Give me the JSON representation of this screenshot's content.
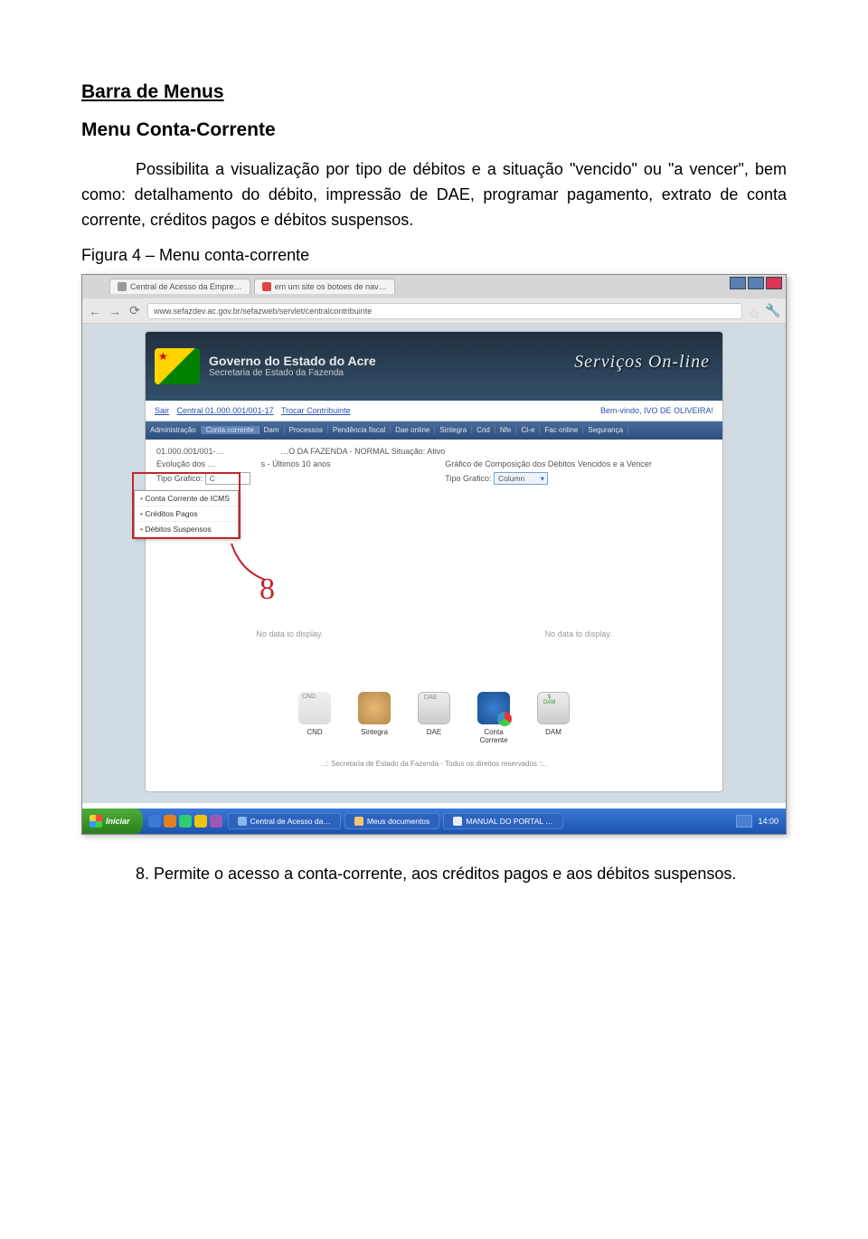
{
  "doc": {
    "title": "Barra de Menus",
    "subtitle": "Menu Conta-Corrente",
    "paragraph1": "Possibilita a visualização por tipo de débitos e a situação \"vencido\" ou \"a vencer\",  bem como: detalhamento do débito, impressão de DAE,  programar pagamento,  extrato de conta corrente, créditos pagos e débitos suspensos.",
    "figure_caption": "Figura 4 – Menu conta-corrente",
    "callout_number": "8",
    "paragraph2": "8. Permite o acesso a conta-corrente, aos créditos pagos e aos débitos suspensos."
  },
  "browser": {
    "tab1": "Central de Acesso da Empre…",
    "tab2": "em um site os botoes de nav…",
    "url": "www.sefazdev.ac.gov.br/sefazweb/servlet/centralcontribuinte"
  },
  "portal": {
    "banner_line1": "Governo do Estado do Acre",
    "banner_line2": "Secretaria de Estado da Fazenda",
    "banner_right": "Serviços On-line",
    "link_sair": "Sair",
    "link_central": "Central 01.000.001/001-17",
    "link_trocar": "Trocar Contribuinte",
    "welcome": "Bem-vindo, IVO DE OLIVEIRA!",
    "menu": {
      "administracao": "Administração",
      "conta_corrente": "Conta corrente",
      "dam": "Dam",
      "processos": "Processos",
      "pendencia": "Pendência fiscal",
      "dae_online": "Dae online",
      "sintegra": "Sintegra",
      "cnd": "Cnd",
      "nfe": "Nfe",
      "cte": "Ct-e",
      "fac": "Fac online",
      "seguranca": "Segurança"
    },
    "dropdown": {
      "icms": "Conta Corrente de ICMS",
      "creditos": "Créditos Pagos",
      "debitos": "Débitos Suspensos"
    },
    "body": {
      "line1_left": "01.000.001/001-…",
      "line1_right": "…O DA FAZENDA - NORMAL Situação: Ativo",
      "line2_left": "Evolução dos …",
      "line2_right": "s - Últimos 10 anos",
      "line2_right_col": "Gráfico de Composição dos Débitos Vencidos e a Vencer",
      "tipo_grafico_label": "Tipo Grafico:",
      "tipo_grafico_left": "C",
      "tipo_grafico_right": "Column",
      "nodata": "No data to display."
    },
    "icons": {
      "cnd": "CND",
      "sintegra": "Sintegra",
      "dae": "DAE",
      "conta": "Conta Corrente",
      "dam": "DAM"
    },
    "footer": "..:: Secretaria de Estado da Fazenda - Todos os direitos reservados ::.."
  },
  "taskbar": {
    "start": "Iniciar",
    "task1": "Central de Acesso da…",
    "task2": "Meus documentos",
    "task3": "MANUAL DO PORTAL …",
    "clock": "14:00"
  }
}
